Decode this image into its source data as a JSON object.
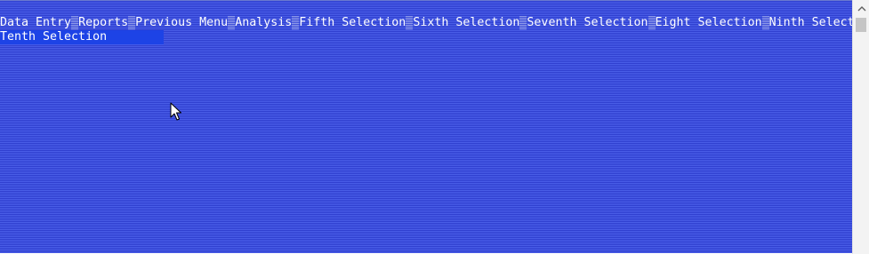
{
  "menu": {
    "line1": [
      {
        "label": "Data Entry"
      },
      {
        "label": "Reports"
      },
      {
        "label": "Previous Menu"
      },
      {
        "label": "Analysis"
      },
      {
        "label": "Fifth Selection"
      },
      {
        "label": "Sixth Selection"
      },
      {
        "label": "Seventh Selection"
      },
      {
        "label": "Eight Selection"
      },
      {
        "label": "Ninth Select"
      }
    ],
    "line2_selected": {
      "label": "Tenth Selection"
    }
  },
  "colors": {
    "screen_bg": "#3548d8",
    "selected_bg": "#1d43e6",
    "text": "#ffffff"
  },
  "icons": {
    "cursor": "mouse-pointer-icon",
    "scroll_up": "chevron-up-icon"
  }
}
